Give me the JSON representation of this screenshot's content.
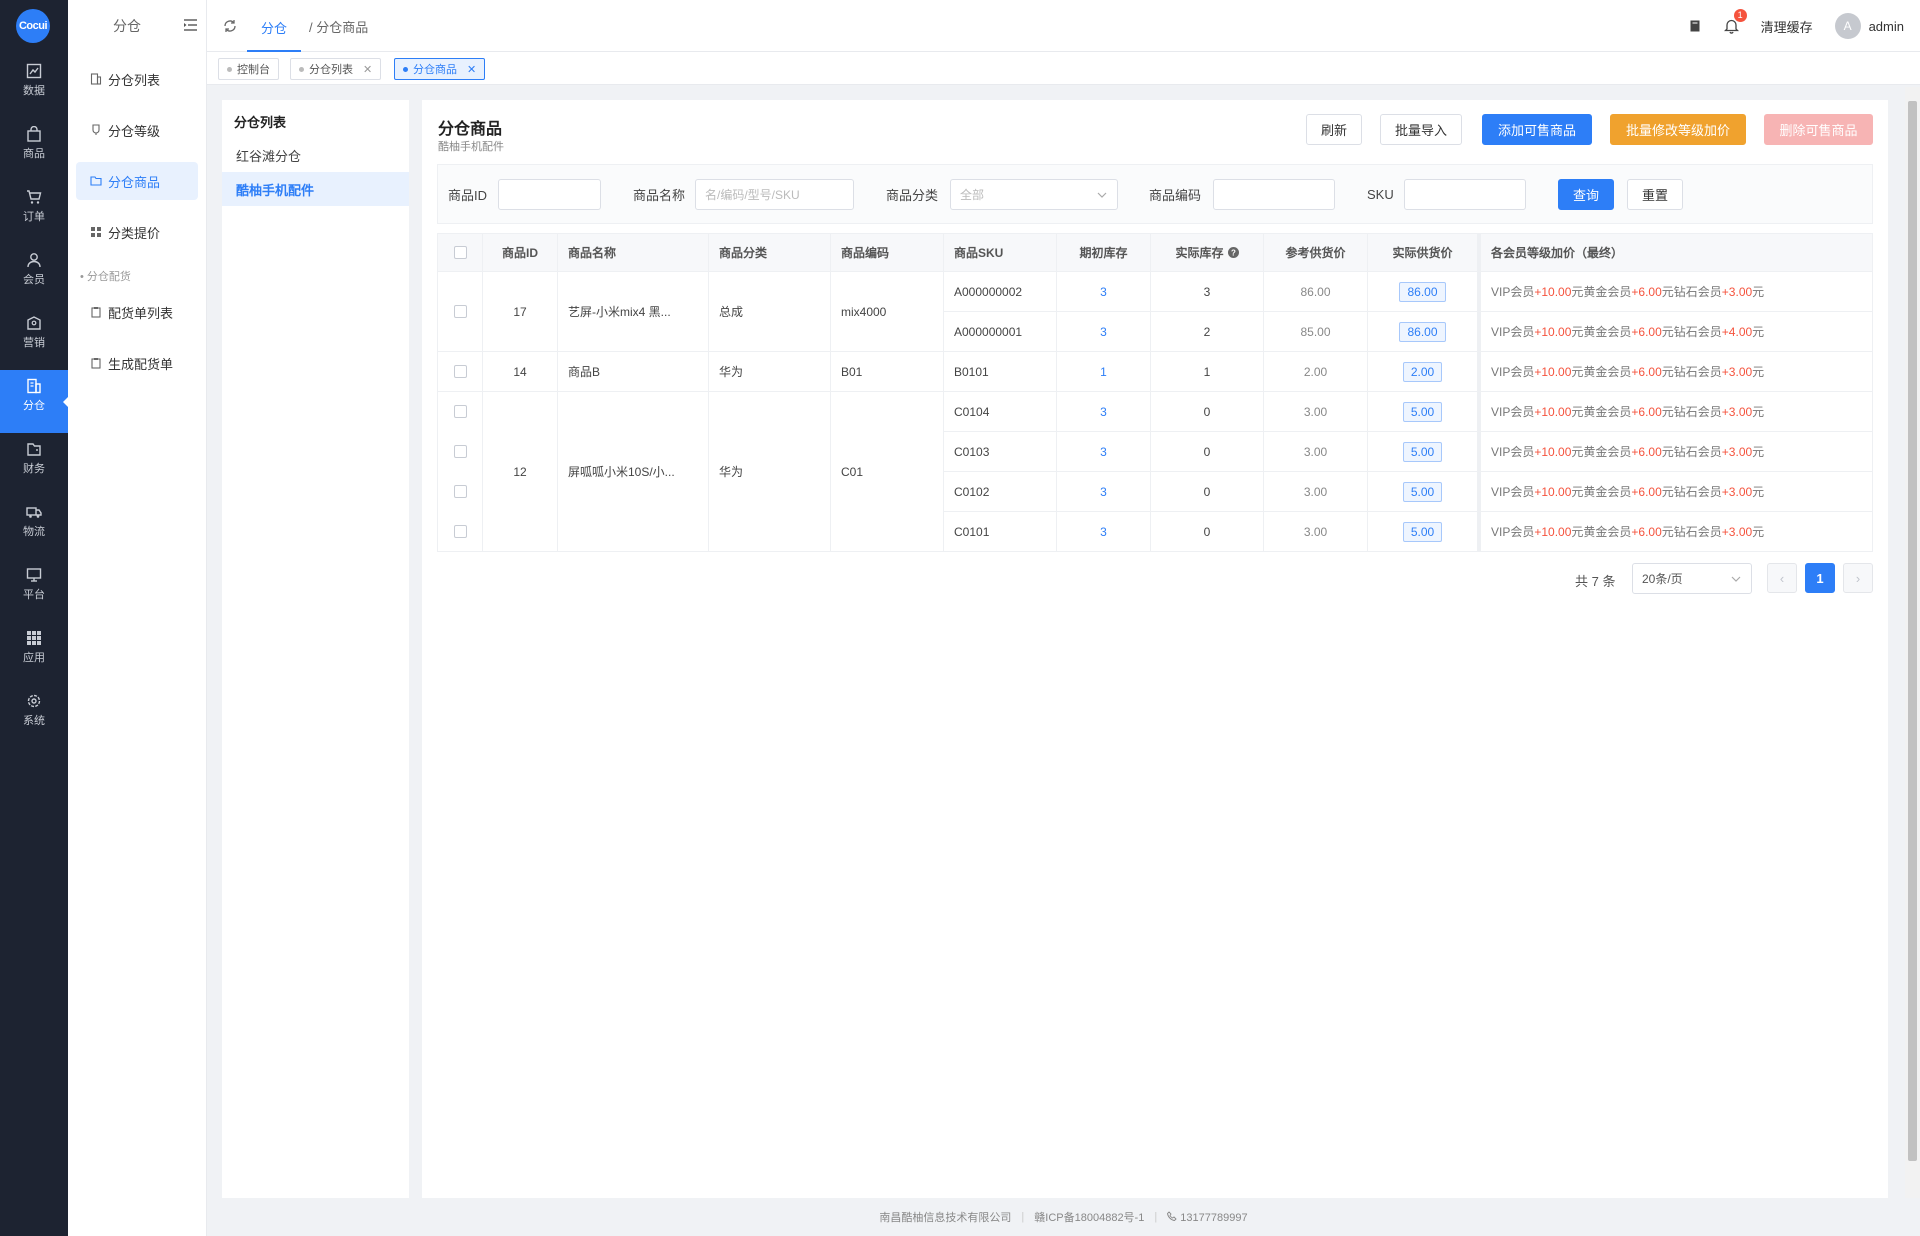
{
  "logo": {
    "text": "Cocui"
  },
  "rail": [
    {
      "label": "数据",
      "icon": "chart-icon"
    },
    {
      "label": "商品",
      "icon": "bag-icon"
    },
    {
      "label": "订单",
      "icon": "cart-icon"
    },
    {
      "label": "会员",
      "icon": "user-icon"
    },
    {
      "label": "营销",
      "icon": "marketing-icon"
    },
    {
      "label": "分仓",
      "icon": "warehouse-icon"
    },
    {
      "label": "财务",
      "icon": "finance-icon"
    },
    {
      "label": "物流",
      "icon": "truck-icon"
    },
    {
      "label": "平台",
      "icon": "monitor-icon"
    },
    {
      "label": "应用",
      "icon": "apps-icon"
    },
    {
      "label": "系统",
      "icon": "gear-icon"
    }
  ],
  "sidebar": {
    "title": "分仓",
    "items": [
      {
        "label": "分仓列表"
      },
      {
        "label": "分仓等级"
      },
      {
        "label": "分仓商品"
      },
      {
        "label": "分类提价"
      }
    ],
    "group": "分仓配货",
    "group_items": [
      {
        "label": "配货单列表"
      },
      {
        "label": "生成配货单"
      }
    ]
  },
  "topbar": {
    "crumb_active": "分仓",
    "crumb_rest": "/ 分仓商品",
    "notify_count": "1",
    "clear_cache": "清理缓存",
    "avatar_letter": "A",
    "username": "admin"
  },
  "tabs": [
    {
      "label": "控制台"
    },
    {
      "label": "分仓列表",
      "close": "✕"
    },
    {
      "label": "分仓商品",
      "close": "✕"
    }
  ],
  "warehouses": {
    "title": "分仓列表",
    "items": [
      {
        "label": "红谷滩分仓"
      },
      {
        "label": "酷柚手机配件"
      }
    ]
  },
  "page": {
    "title": "分仓商品",
    "subtitle": "酷柚手机配件",
    "buttons": {
      "refresh": "刷新",
      "import": "批量导入",
      "add": "添加可售商品",
      "batch_markup": "批量修改等级加价",
      "delete": "删除可售商品"
    }
  },
  "filters": {
    "id_label": "商品ID",
    "name_label": "商品名称",
    "name_placeholder": "名/编码/型号/SKU",
    "cat_label": "商品分类",
    "cat_value": "全部",
    "code_label": "商品编码",
    "sku_label": "SKU",
    "query": "查询",
    "reset": "重置"
  },
  "table": {
    "headers": [
      "商品ID",
      "商品名称",
      "商品分类",
      "商品编码",
      "商品SKU",
      "期初库存",
      "实际库存",
      "参考供货价",
      "实际供货价",
      "各会员等级加价（最终）"
    ],
    "groups": [
      {
        "id": "17",
        "name": "艺屏-小米mix4 黑...",
        "category": "总成",
        "code": "mix4000"
      },
      {
        "id": "14",
        "name": "商品B",
        "category": "华为",
        "code": "B01"
      },
      {
        "id": "12",
        "name": "屏呱呱小米10S/小...",
        "category": "华为",
        "code": "C01"
      }
    ],
    "rows": [
      {
        "sku": "A000000002",
        "init_stock": "3",
        "stock": "3",
        "ref_price": "86.00",
        "price": "86.00",
        "vip": "+10.00",
        "gold": "+6.00",
        "diamond": "+3.00"
      },
      {
        "sku": "A000000001",
        "init_stock": "3",
        "stock": "2",
        "ref_price": "85.00",
        "price": "86.00",
        "vip": "+10.00",
        "gold": "+6.00",
        "diamond": "+4.00"
      },
      {
        "sku": "B0101",
        "init_stock": "1",
        "stock": "1",
        "ref_price": "2.00",
        "price": "2.00",
        "vip": "+10.00",
        "gold": "+6.00",
        "diamond": "+3.00"
      },
      {
        "sku": "C0104",
        "init_stock": "3",
        "stock": "0",
        "ref_price": "3.00",
        "price": "5.00",
        "vip": "+10.00",
        "gold": "+6.00",
        "diamond": "+3.00"
      },
      {
        "sku": "C0103",
        "init_stock": "3",
        "stock": "0",
        "ref_price": "3.00",
        "price": "5.00",
        "vip": "+10.00",
        "gold": "+6.00",
        "diamond": "+3.00"
      },
      {
        "sku": "C0102",
        "init_stock": "3",
        "stock": "0",
        "ref_price": "3.00",
        "price": "5.00",
        "vip": "+10.00",
        "gold": "+6.00",
        "diamond": "+3.00"
      },
      {
        "sku": "C0101",
        "init_stock": "3",
        "stock": "0",
        "ref_price": "3.00",
        "price": "5.00",
        "vip": "+10.00",
        "gold": "+6.00",
        "diamond": "+3.00"
      }
    ],
    "markup_labels": {
      "vip": "VIP会员",
      "gold": "元黄金会员",
      "diamond": "元钻石会员",
      "unit": "元"
    }
  },
  "pagination": {
    "total": "共 7 条",
    "page_size": "20条/页",
    "current": "1",
    "prev": "‹",
    "next": "›"
  },
  "footer": {
    "company": "南昌酷柚信息技术有限公司",
    "icp": "赣ICP备18004882号-1",
    "phone": "13177789997"
  }
}
